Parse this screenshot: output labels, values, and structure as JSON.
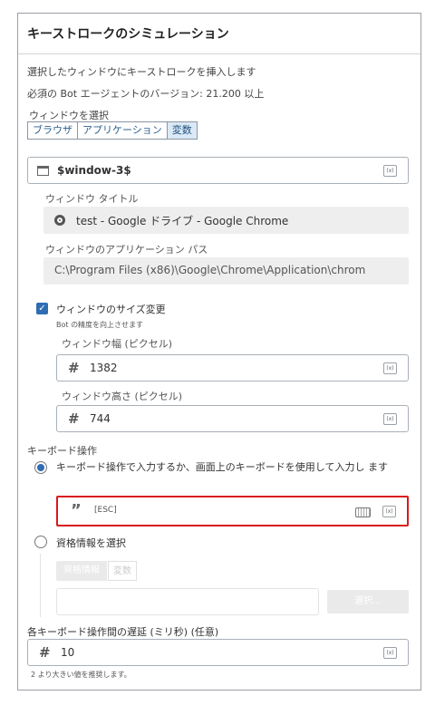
{
  "header": {
    "title": "キーストロークのシミュレーション"
  },
  "description": "選択したウィンドウにキーストロークを挿入します",
  "version_note": "必須の Bot エージェントのバージョン: 21.200 以上",
  "window_select": {
    "label": "ウィンドウを選択",
    "options": [
      "ブラウザ",
      "アプリケーション",
      "変数"
    ],
    "active": "変数",
    "variable_value": "$window-3$"
  },
  "window_title": {
    "label": "ウィンドウ タイトル",
    "value": "test - Google ドライブ - Google Chrome"
  },
  "app_path": {
    "label": "ウィンドウのアプリケーション パス",
    "value": "C:\\Program Files (x86)\\Google\\Chrome\\Application\\chrom"
  },
  "resize": {
    "checkbox_label": "ウィンドウのサイズ変更",
    "checked": true,
    "hint": "Bot の精度を向上させます",
    "width_label": "ウィンドウ幅 (ピクセル)",
    "width_value": "1382",
    "height_label": "ウィンドウ高さ (ピクセル)",
    "height_value": "744"
  },
  "keyboard": {
    "section_label": "キーボード操作",
    "option1_label": "キーボード操作で入力するか、画面上のキーボードを使用して入力し ます",
    "option1_selected": true,
    "input_value": "[ESC]",
    "option2_label": "資格情報を選択",
    "cred_tabs": [
      "資格情報",
      "変数"
    ],
    "select_button": "選択..."
  },
  "delay": {
    "label": "各キーボード操作間の遅延 (ミリ秒) (任意)",
    "value": "10",
    "hint": "2 より大きい値を推奨します。"
  },
  "icons": {
    "fx": "(x)"
  },
  "colors": {
    "accent": "#2e6db4",
    "highlight": "#d7191c"
  }
}
